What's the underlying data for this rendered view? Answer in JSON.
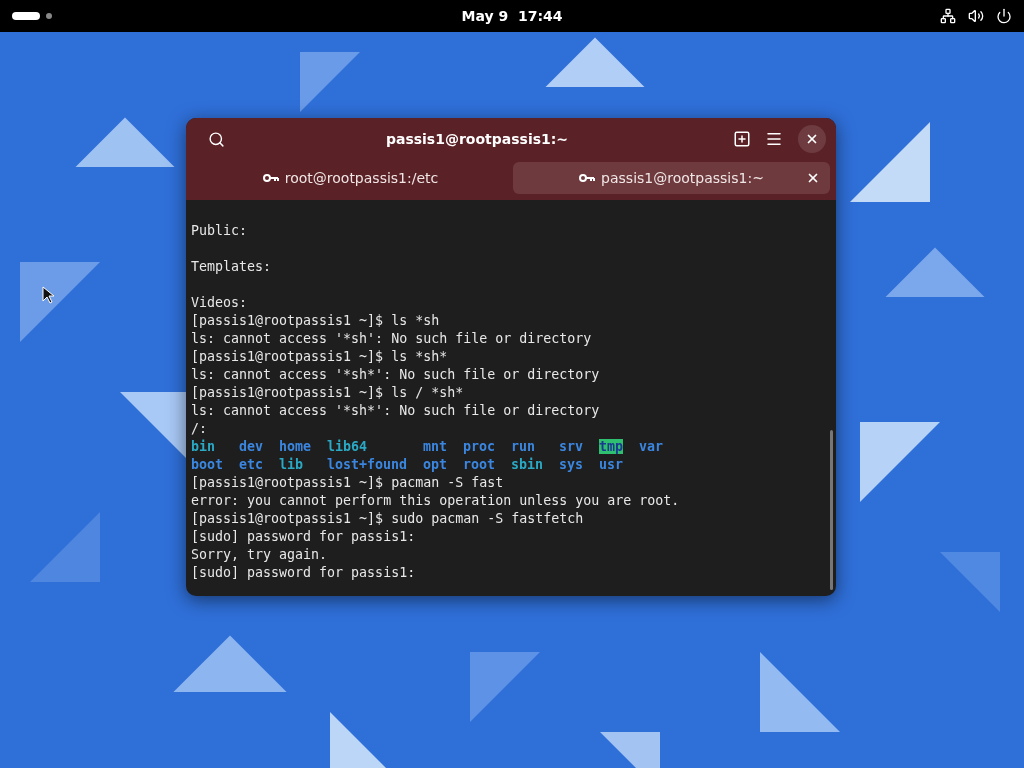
{
  "top_bar": {
    "clock": "May 9  17:44"
  },
  "window": {
    "title": "passis1@rootpassis1:~",
    "tabs": [
      {
        "label": "root@rootpassis1:/etc",
        "selected": false
      },
      {
        "label": "passis1@rootpassis1:~",
        "selected": true
      }
    ],
    "terminal": {
      "lines": [
        {
          "kind": "text",
          "text": "Public:"
        },
        {
          "kind": "blank"
        },
        {
          "kind": "text",
          "text": "Templates:"
        },
        {
          "kind": "blank"
        },
        {
          "kind": "text",
          "text": "Videos:"
        },
        {
          "kind": "text",
          "text": "[passis1@rootpassis1 ~]$ ls *sh"
        },
        {
          "kind": "text",
          "text": "ls: cannot access '*sh': No such file or directory"
        },
        {
          "kind": "text",
          "text": "[passis1@rootpassis1 ~]$ ls *sh*"
        },
        {
          "kind": "text",
          "text": "ls: cannot access '*sh*': No such file or directory"
        },
        {
          "kind": "text",
          "text": "[passis1@rootpassis1 ~]$ ls / *sh*"
        },
        {
          "kind": "text",
          "text": "ls: cannot access '*sh*': No such file or directory"
        },
        {
          "kind": "text",
          "text": "/:"
        },
        {
          "kind": "listing",
          "items": [
            {
              "text": "bin",
              "color": "#2aa8c4",
              "highlighted": false
            },
            {
              "text": "dev",
              "color": "#3a86e0",
              "highlighted": false
            },
            {
              "text": "home",
              "color": "#3a86e0",
              "highlighted": false
            },
            {
              "text": "lib64",
              "color": "#2aa8c4",
              "highlighted": false
            },
            {
              "text": "mnt",
              "color": "#3a86e0",
              "highlighted": false
            },
            {
              "text": "proc",
              "color": "#3a86e0",
              "highlighted": false
            },
            {
              "text": "run",
              "color": "#3a86e0",
              "highlighted": false
            },
            {
              "text": "srv",
              "color": "#3a86e0",
              "highlighted": false
            },
            {
              "text": "tmp",
              "highlighted": true
            },
            {
              "text": "var",
              "color": "#3a86e0",
              "highlighted": false
            }
          ]
        },
        {
          "kind": "listing",
          "items": [
            {
              "text": "boot",
              "color": "#3a86e0",
              "highlighted": false
            },
            {
              "text": "etc",
              "color": "#3a86e0",
              "highlighted": false
            },
            {
              "text": "lib",
              "color": "#2aa8c4",
              "highlighted": false
            },
            {
              "text": "lost+found",
              "color": "#3a86e0",
              "highlighted": false
            },
            {
              "text": "opt",
              "color": "#3a86e0",
              "highlighted": false
            },
            {
              "text": "root",
              "color": "#3a86e0",
              "highlighted": false
            },
            {
              "text": "sbin",
              "color": "#2aa8c4",
              "highlighted": false
            },
            {
              "text": "sys",
              "color": "#3a86e0",
              "highlighted": false
            },
            {
              "text": "usr",
              "color": "#3a86e0",
              "highlighted": false
            }
          ]
        },
        {
          "kind": "text",
          "text": "[passis1@rootpassis1 ~]$ pacman -S fast"
        },
        {
          "kind": "text",
          "text": "error: you cannot perform this operation unless you are root."
        },
        {
          "kind": "text",
          "text": "[passis1@rootpassis1 ~]$ sudo pacman -S fastfetch"
        },
        {
          "kind": "text",
          "text": "[sudo] password for passis1:"
        },
        {
          "kind": "text",
          "text": "Sorry, try again."
        },
        {
          "kind": "text",
          "text": "[sudo] password for passis1:"
        }
      ]
    }
  }
}
